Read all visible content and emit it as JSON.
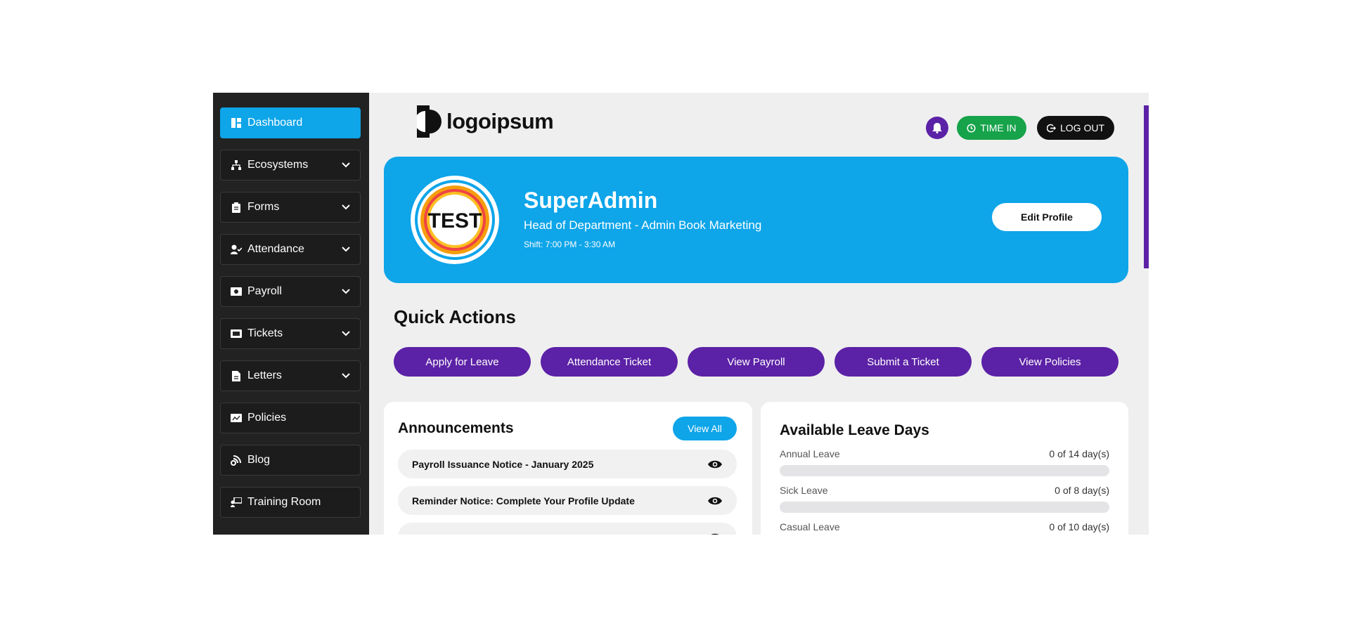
{
  "sidebar": {
    "items": [
      {
        "label": "Dashboard",
        "icon": "dashboard-icon",
        "active": true
      },
      {
        "label": "Ecosystems",
        "icon": "sitemap-icon"
      },
      {
        "label": "Forms",
        "icon": "clipboard-icon"
      },
      {
        "label": "Attendance",
        "icon": "user-check-icon"
      },
      {
        "label": "Payroll",
        "icon": "money-icon"
      },
      {
        "label": "Tickets",
        "icon": "ticket-icon"
      },
      {
        "label": "Letters",
        "icon": "file-icon"
      },
      {
        "label": "Policies",
        "icon": "policy-icon"
      },
      {
        "label": "Blog",
        "icon": "blog-icon"
      },
      {
        "label": "Training Room",
        "icon": "training-icon"
      }
    ]
  },
  "header": {
    "logo_text": "logoipsum",
    "time_in_label": "TIME IN",
    "logout_label": "LOG OUT",
    "colors": {
      "primary": "#0ea5e9",
      "accent": "#5b21a6",
      "success": "#16a34a"
    }
  },
  "profile": {
    "avatar_text": "TEST",
    "name": "SuperAdmin",
    "role": "Head of Department - Admin Book Marketing",
    "shift": "Shift: 7:00 PM - 3:30 AM",
    "edit_label": "Edit Profile"
  },
  "quick_actions": {
    "title": "Quick Actions",
    "buttons": [
      "Apply for Leave",
      "Attendance Ticket",
      "View Payroll",
      "Submit a Ticket",
      "View Policies"
    ]
  },
  "announcements": {
    "title": "Announcements",
    "view_all_label": "View All",
    "items": [
      "Payroll Issuance Notice - January 2025",
      "Reminder Notice: Complete Your Profile Update"
    ]
  },
  "leave": {
    "title": "Available Leave Days",
    "items": [
      {
        "label": "Annual Leave",
        "value": "0 of 14 day(s)",
        "used_fraction": 0
      },
      {
        "label": "Sick Leave",
        "value": "0 of 8 day(s)",
        "used_fraction": 0
      },
      {
        "label": "Casual Leave",
        "value": "0 of 10 day(s)",
        "used_fraction": 0
      }
    ]
  }
}
